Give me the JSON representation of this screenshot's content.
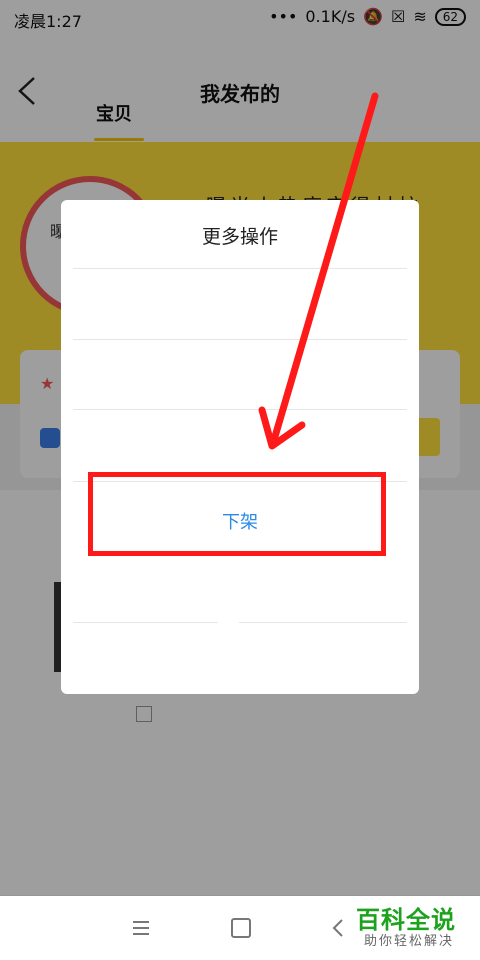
{
  "status_bar": {
    "time": "凌晨1:27",
    "speed": "0.1K/s",
    "battery": "62"
  },
  "header": {
    "title": "我发布的",
    "tab": "宝贝"
  },
  "background": {
    "ring_label": "曝",
    "banner_text": "曝光火热度宝得材柱"
  },
  "dialog": {
    "title": "更多操作",
    "options": [
      "",
      "",
      "下架",
      ""
    ]
  },
  "watermark": {
    "big": "百科全说",
    "small": "助你轻松解决"
  },
  "colors": {
    "accent": "#2c8be8",
    "banner": "#ffe03d",
    "annotation": "#ff1a1a"
  },
  "icons": [
    "back-icon",
    "signal-dots-icon",
    "mute-icon",
    "close-box-icon",
    "wifi-icon",
    "battery-icon",
    "menu-icon",
    "home-icon",
    "nav-back-icon"
  ]
}
